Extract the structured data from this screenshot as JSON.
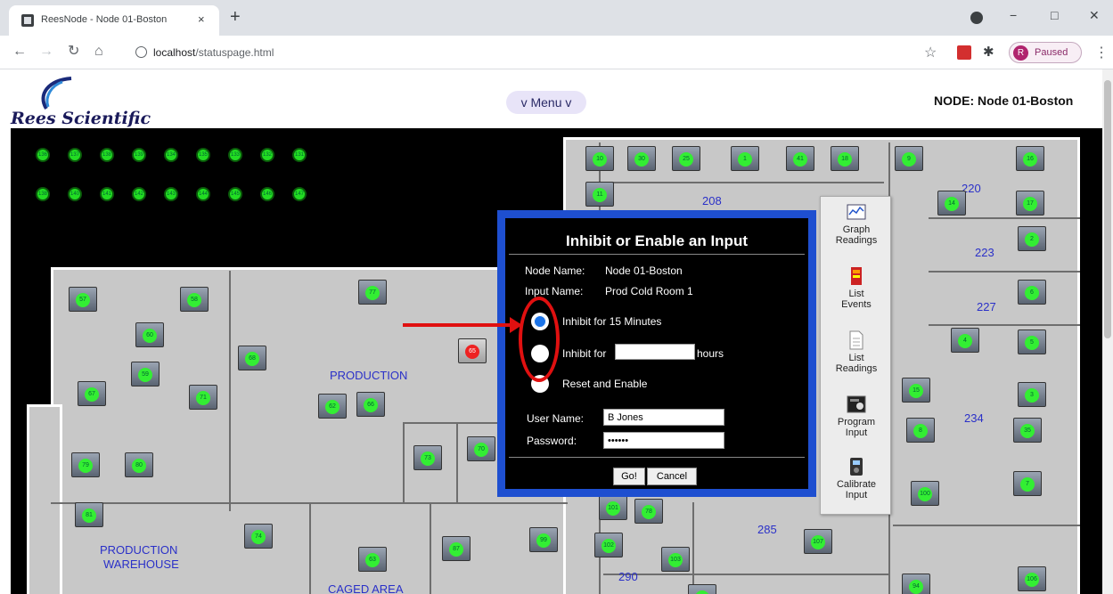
{
  "browser": {
    "tab_title": "ReesNode - Node 01-Boston",
    "tab_close": "×",
    "new_tab": "+",
    "url_host": "localhost",
    "url_path": "/statuspage.html",
    "profile_initial": "R",
    "profile_label": "Paused",
    "minimize": "−",
    "restore": "□",
    "close": "✕"
  },
  "header": {
    "logo_text": "Rees Scientific",
    "menu_label": "v Menu v",
    "node_label": "NODE: Node 01-Boston"
  },
  "map": {
    "rooms": {
      "r208": "208",
      "r220": "220",
      "r223": "223",
      "r227": "227",
      "r234": "234",
      "r285": "285",
      "r290": "290",
      "production": "PRODUCTION",
      "production_warehouse_1": "PRODUCTION",
      "production_warehouse_2": "WAREHOUSE",
      "caged_area": "CAGED AREA"
    },
    "status_dots_row1": [
      "136",
      "137",
      "138",
      "139",
      "134",
      "135",
      "133",
      "132",
      "131"
    ],
    "status_dots_row2": [
      "138",
      "140",
      "141",
      "142",
      "143",
      "144",
      "145",
      "146",
      "147"
    ],
    "sensors": [
      {
        "label": "57"
      },
      {
        "label": "58"
      },
      {
        "label": "77"
      },
      {
        "label": "60"
      },
      {
        "label": "59"
      },
      {
        "label": "68"
      },
      {
        "label": "67"
      },
      {
        "label": "71"
      },
      {
        "label": "62"
      },
      {
        "label": "66"
      },
      {
        "label": "79"
      },
      {
        "label": "80"
      },
      {
        "label": "81"
      },
      {
        "label": "74"
      },
      {
        "label": "63"
      },
      {
        "label": "73"
      },
      {
        "label": "70"
      },
      {
        "label": "87"
      },
      {
        "label": "99"
      },
      {
        "label": "10"
      },
      {
        "label": "30"
      },
      {
        "label": "11"
      },
      {
        "label": "25"
      },
      {
        "label": "1"
      },
      {
        "label": "41"
      },
      {
        "label": "18"
      },
      {
        "label": "9"
      },
      {
        "label": "16"
      },
      {
        "label": "14"
      },
      {
        "label": "17"
      },
      {
        "label": "2"
      },
      {
        "label": "6"
      },
      {
        "label": "4"
      },
      {
        "label": "5"
      },
      {
        "label": "15"
      },
      {
        "label": "3"
      },
      {
        "label": "35"
      },
      {
        "label": "8"
      },
      {
        "label": "7"
      },
      {
        "label": "100"
      },
      {
        "label": "101"
      },
      {
        "label": "78"
      },
      {
        "label": "102"
      },
      {
        "label": "103"
      },
      {
        "label": "107"
      },
      {
        "label": "106"
      },
      {
        "label": "94"
      },
      {
        "label": "12"
      }
    ],
    "alarm_sensor": "65"
  },
  "dialog": {
    "title": "Inhibit or Enable an Input",
    "node_name_label": "Node Name:",
    "node_name_value": "Node 01-Boston",
    "input_name_label": "Input Name:",
    "input_name_value": "Prod Cold Room 1",
    "option1": "Inhibit for 15 Minutes",
    "option2_prefix": "Inhibit for",
    "option2_suffix": "hours",
    "option3": "Reset and Enable",
    "hours_value": "",
    "user_label": "User Name:",
    "user_value": "B Jones",
    "password_label": "Password:",
    "password_value": "••••••",
    "go_label": "Go!",
    "cancel_label": "Cancel"
  },
  "side_menu": {
    "items": [
      {
        "line1": "Graph",
        "line2": "Readings"
      },
      {
        "line1": "List",
        "line2": "Events"
      },
      {
        "line1": "List",
        "line2": "Readings"
      },
      {
        "line1": "Program",
        "line2": "Input"
      },
      {
        "line1": "Calibrate",
        "line2": "Input"
      }
    ]
  },
  "colors": {
    "dialog_border": "#1e4fd0",
    "annotation": "#e01010",
    "ok_dot": "#22dd22",
    "alarm_dot": "#ee2222",
    "room_label": "#2a30c8"
  }
}
